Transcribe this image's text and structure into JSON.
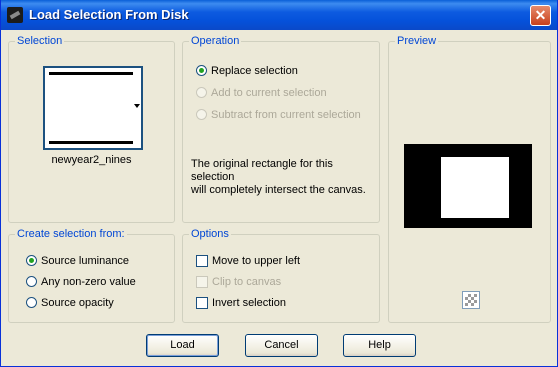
{
  "window": {
    "title": "Load Selection From Disk",
    "close_label": "✕"
  },
  "selection_group": {
    "label": "Selection",
    "file_name": "newyear2_nines"
  },
  "operation_group": {
    "label": "Operation",
    "options": [
      {
        "label": "Replace selection",
        "selected": true,
        "enabled": true
      },
      {
        "label": "Add to current selection",
        "selected": false,
        "enabled": false
      },
      {
        "label": "Subtract from current selection",
        "selected": false,
        "enabled": false
      }
    ],
    "info_line1": "The original rectangle for this selection",
    "info_line2": "will completely intersect the canvas."
  },
  "preview_group": {
    "label": "Preview",
    "bg_color": "#000000",
    "rect_color": "#ffffff"
  },
  "create_group": {
    "label": "Create selection from:",
    "options": [
      {
        "label": "Source luminance",
        "selected": true
      },
      {
        "label": "Any non-zero value",
        "selected": false
      },
      {
        "label": "Source opacity",
        "selected": false
      }
    ]
  },
  "options_group": {
    "label": "Options",
    "items": [
      {
        "label": "Move to upper left",
        "checked": false,
        "enabled": true
      },
      {
        "label": "Clip to canvas",
        "checked": false,
        "enabled": false
      },
      {
        "label": "Invert selection",
        "checked": false,
        "enabled": true
      }
    ]
  },
  "buttons": {
    "load": "Load",
    "cancel": "Cancel",
    "help": "Help"
  }
}
